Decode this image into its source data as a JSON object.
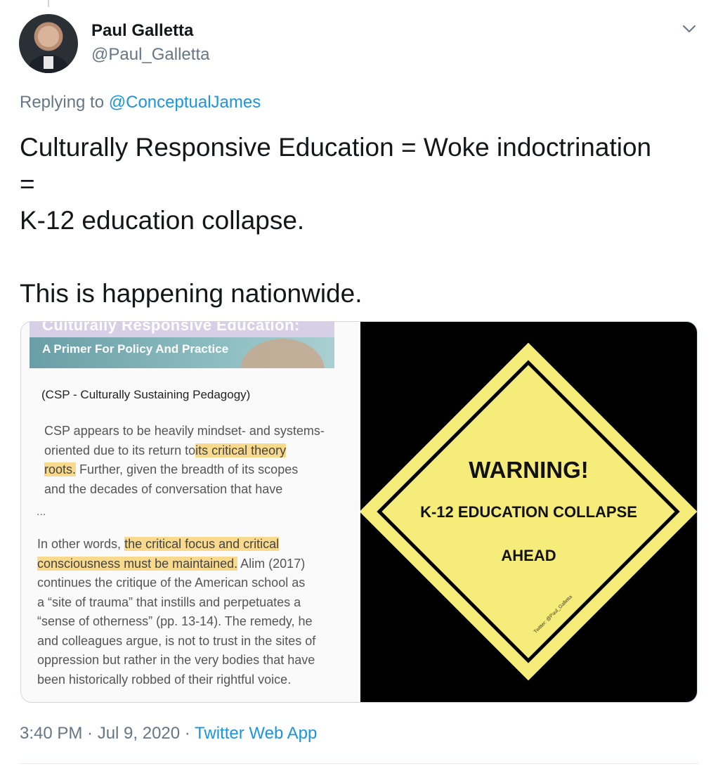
{
  "author": {
    "name": "Paul Galletta",
    "handle": "@Paul_Galletta"
  },
  "reply": {
    "prefix": "Replying to",
    "to": "@ConceptualJames"
  },
  "tweet": {
    "lines": [
      "Culturally Responsive Education = Woke indoctrination",
      "=",
      "K-12 education collapse.",
      "",
      "This is happening nationwide."
    ]
  },
  "image_left": {
    "banner_title": "Culturally Responsive Education:",
    "banner_subtitle": "A Primer For Policy And Practice",
    "section_title": "(CSP - Culturally Sustaining Pedagogy)",
    "p1_a": "CSP appears to be heavily mindset- and systems-",
    "p1_b": "oriented due to its return to",
    "p1_hl1": "its critical theory",
    "p1_hl2": "roots.",
    "p1_c": " Further, given the breadth of its scopes",
    "p1_d": "and the decades of conversation that have",
    "ellipsis": "...",
    "p2_a": "In other words, ",
    "p2_hl1": "the critical focus and critical",
    "p2_hl2": "consciousness must be maintained.",
    "p2_b": " Alim (2017)",
    "p2_c": "continues the critique of the American school as",
    "p2_d": "a “site of trauma” that instills and perpetuates a",
    "p2_e": "“sense of otherness” (pp. 13-14). The remedy, he",
    "p2_f": "and colleagues argue, is not to trust in the sites of",
    "p2_g": "oppression but rather in the very bodies that have",
    "p2_h": "been historically robbed of their rightful voice."
  },
  "image_right": {
    "line1": "WARNING!",
    "line2": "K-12 EDUCATION COLLAPSE",
    "line3": "AHEAD",
    "watermark": "Twitter: @Paul_Galletta",
    "colors": {
      "sign": "#f6ec7a",
      "background": "#000000"
    }
  },
  "meta": {
    "time": "3:40 PM · Jul 9, 2020 · ",
    "source": "Twitter Web App"
  },
  "colors": {
    "link": "#1b95e0",
    "muted": "#657786"
  }
}
